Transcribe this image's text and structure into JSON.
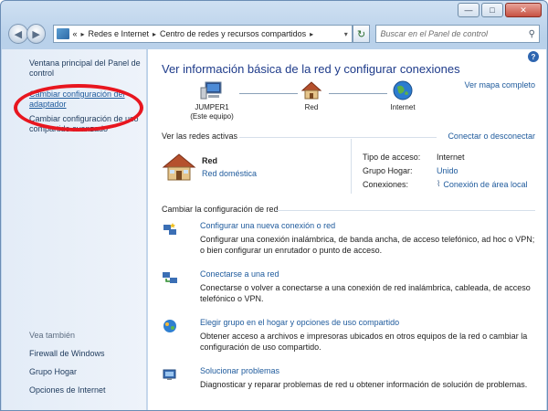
{
  "window": {
    "caption_minimize": "—",
    "caption_maximize": "□",
    "caption_close": "✕"
  },
  "navbar": {
    "back": "◀",
    "forward": "▶",
    "address_overflow": "«",
    "breadcrumb": [
      "Redes e Internet",
      "Centro de redes y recursos compartidos"
    ],
    "separator": "▸",
    "dropdown": "▾",
    "refresh": "↻",
    "search_placeholder": "Buscar en el Panel de control",
    "search_glyph": "⚲"
  },
  "left_pane": {
    "links": [
      "Ventana principal del Panel de control",
      "Cambiar configuración del adaptador",
      "Cambiar configuración de uso compartido avanzado"
    ],
    "see_also_label": "Vea también",
    "see_also": [
      "Firewall de Windows",
      "Grupo Hogar",
      "Opciones de Internet"
    ]
  },
  "main": {
    "help": "?",
    "title": "Ver información básica de la red y configurar conexiones",
    "map_link": "Ver mapa completo",
    "nodes": [
      {
        "label": "JUMPER1",
        "sub": "(Este equipo)",
        "icon": "computer-icon"
      },
      {
        "label": "Red",
        "sub": "",
        "icon": "house-icon"
      },
      {
        "label": "Internet",
        "sub": "",
        "icon": "globe-icon"
      }
    ],
    "active_label": "Ver las redes activas",
    "connect_link": "Conectar o desconectar",
    "active_network": {
      "name": "Red",
      "type": "Red doméstica"
    },
    "properties": [
      {
        "key": "Tipo de acceso:",
        "value": "Internet",
        "link": false
      },
      {
        "key": "Grupo Hogar:",
        "value": "Unido",
        "link": true
      },
      {
        "key": "Conexiones:",
        "value": "Conexión de área local",
        "link": true
      }
    ],
    "change_label": "Cambiar la configuración de red",
    "tasks": [
      {
        "title": "Configurar una nueva conexión o red",
        "desc": "Configurar una conexión inalámbrica, de banda ancha, de acceso telefónico, ad hoc o VPN; o bien configurar un enrutador o punto de acceso.",
        "icon": "new-connection-icon"
      },
      {
        "title": "Conectarse a una red",
        "desc": "Conectarse o volver a conectarse a una conexión de red inalámbrica, cableada, de acceso telefónico o VPN.",
        "icon": "connect-network-icon"
      },
      {
        "title": "Elegir grupo en el hogar y opciones de uso compartido",
        "desc": "Obtener acceso a archivos e impresoras ubicados en otros equipos de la red o cambiar la configuración de uso compartido.",
        "icon": "homegroup-icon"
      },
      {
        "title": "Solucionar problemas",
        "desc": "Diagnosticar y reparar problemas de red u obtener información de solución de problemas.",
        "icon": "troubleshoot-icon"
      }
    ]
  },
  "colors": {
    "link": "#1e5a9c",
    "title": "#1e3b8a",
    "annotation": "#e8161f"
  }
}
